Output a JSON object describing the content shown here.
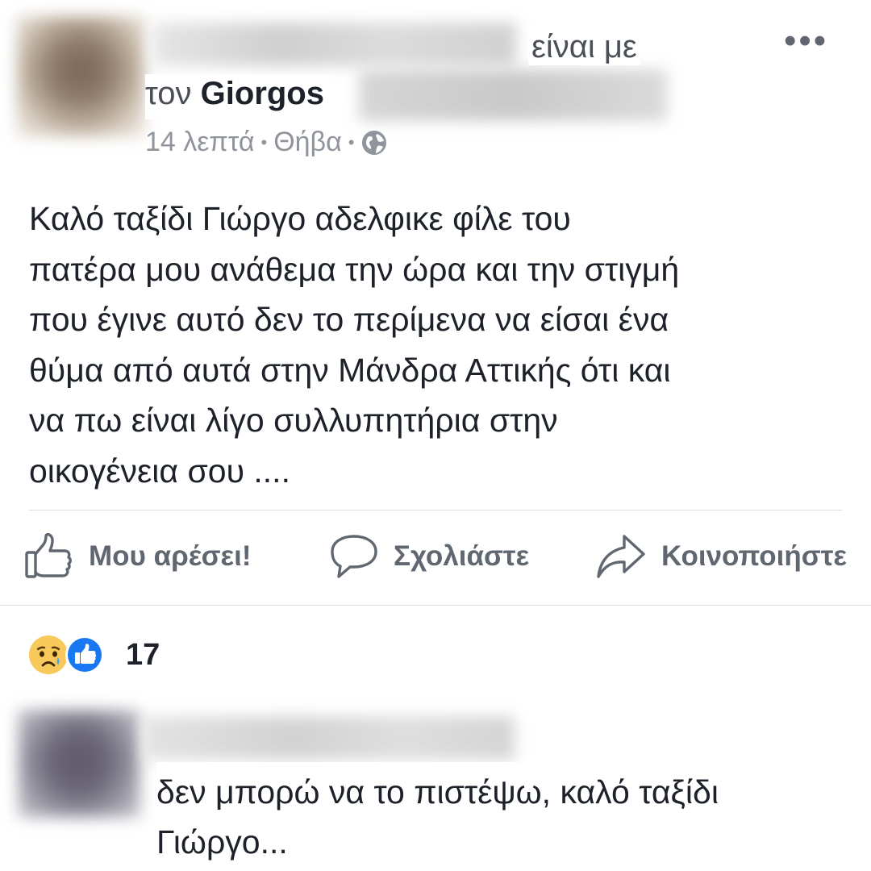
{
  "post": {
    "with_text": "είναι με",
    "tagged_prefix": "τον",
    "tagged_name": "Giorgos",
    "meta": {
      "time": "14 λεπτά",
      "location": "Θήβα",
      "separator": "•",
      "privacy_icon": "globe-icon"
    },
    "more_icon": "•••",
    "body_lines": [
      "Καλό ταξίδι Γιώργο αδελφικε φίλε του",
      "πατέρα μου ανάθεμα την ώρα και την στιγμή",
      "που έγινε αυτό δεν το περίμενα να είσαι ένα",
      "θύμα από αυτά στην Μάνδρα Αττικής ότι και",
      "να πω είναι λίγο συλλυπητήρια στην",
      "οικογένεια σου ...."
    ]
  },
  "actions": {
    "like_label": "Μου αρέσει!",
    "comment_label": "Σχολιάστε",
    "share_label": "Κοινοποιήστε"
  },
  "reactions": {
    "icons": [
      "sad-icon",
      "like-icon"
    ],
    "count": "17",
    "like_color": "#1877f2",
    "sad_color": "#f7c85a"
  },
  "comment": {
    "text_lines": [
      "δεν μπορώ να το πιστέψω, καλό ταξίδι",
      "Γιώργο..."
    ]
  }
}
